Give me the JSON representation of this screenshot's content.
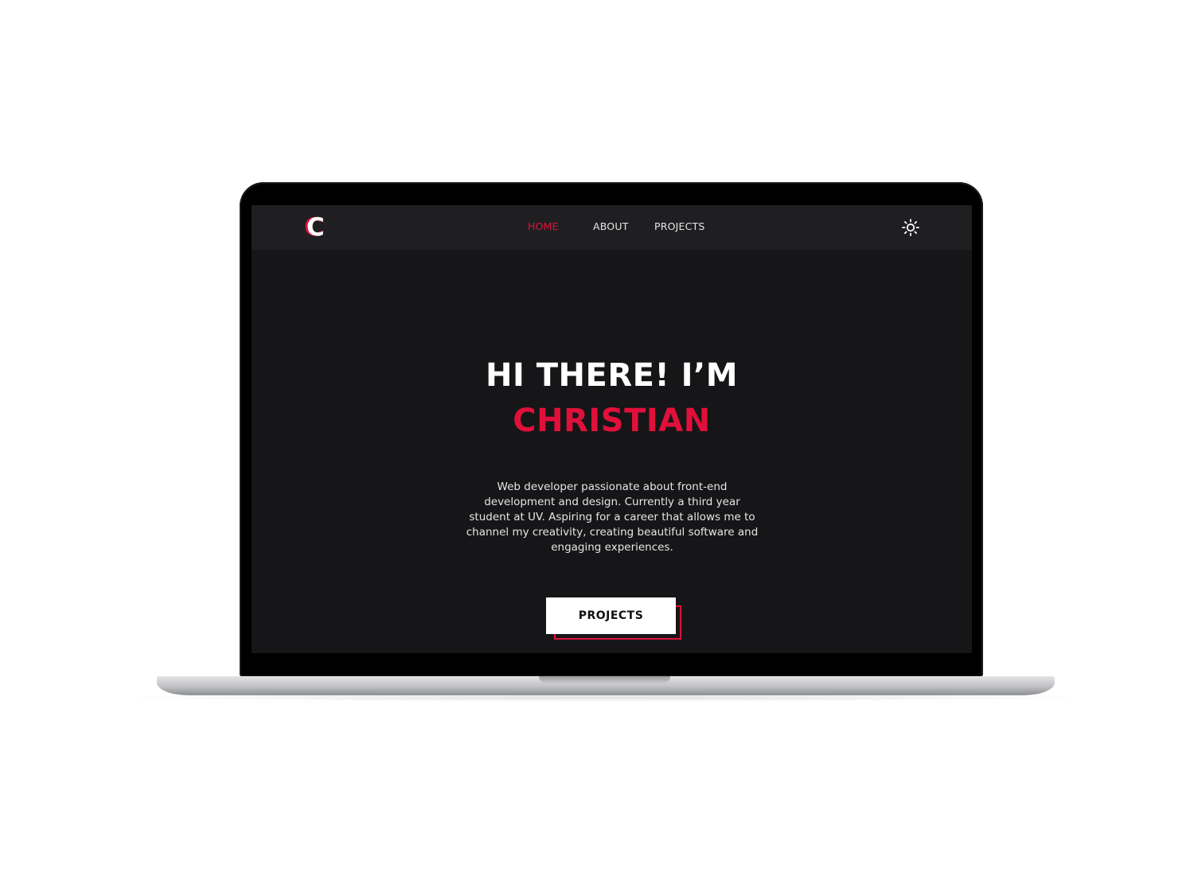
{
  "app": {
    "logo_letter": "C"
  },
  "nav": {
    "items": [
      {
        "label": "HOME",
        "active": true
      },
      {
        "label": "ABOUT",
        "active": false
      },
      {
        "label": "PROJECTS",
        "active": false
      }
    ],
    "theme_toggle_icon": "sun-icon"
  },
  "hero": {
    "title_line1": "HI THERE! I’M",
    "title_line2": "CHRISTIAN",
    "description": "Web developer passionate about front-end development and design. Currently a third year student at UV. Aspiring for a career that allows me to channel my creativity, creating beautiful software and engaging experiences.",
    "cta_label": "PROJECTS"
  },
  "colors": {
    "accent": "#e0103a",
    "background": "#161618",
    "navbar": "#1f1f22",
    "text": "#ffffff"
  }
}
